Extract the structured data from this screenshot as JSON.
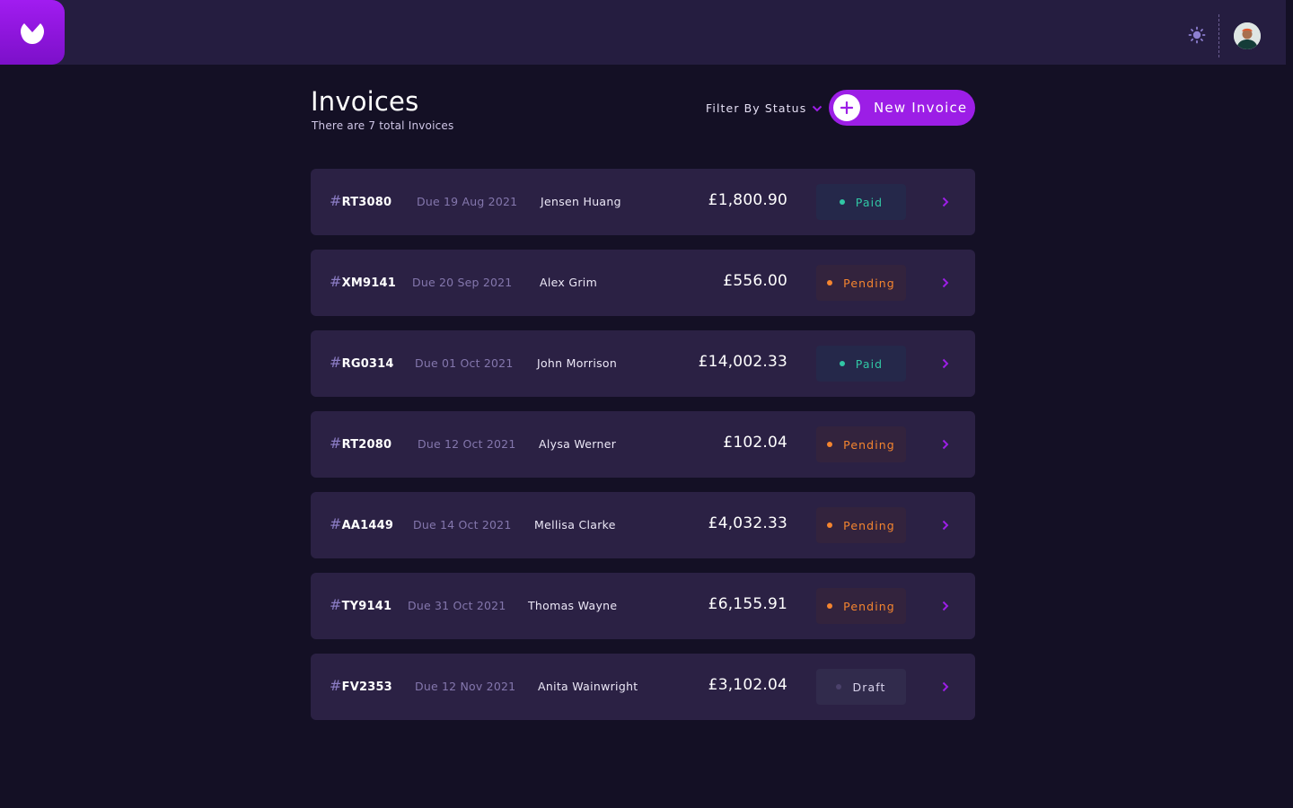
{
  "header": {
    "title": "Invoices",
    "subtitle": "There are 7 total Invoices",
    "filter_label": "Filter By Status",
    "new_invoice_label": "New Invoice"
  },
  "icons": {
    "logo": "logo-icon",
    "theme": "sun-icon",
    "filter": "chevron-down-icon",
    "plus": "plus-icon",
    "row": "chevron-right-icon"
  },
  "colors": {
    "accent": "#9c1ee6",
    "paid": "#31c7a5",
    "pending": "#f5852f",
    "draft": "#d9d3ec"
  },
  "invoices": [
    {
      "hash": "#",
      "id": "RT3080",
      "due": "Due 19 Aug 2021",
      "client": "Jensen Huang",
      "amount": "£1,800.90",
      "status": "Paid"
    },
    {
      "hash": "#",
      "id": "XM9141",
      "due": "Due 20 Sep 2021",
      "client": "Alex Grim",
      "amount": "£556.00",
      "status": "Pending"
    },
    {
      "hash": "#",
      "id": "RG0314",
      "due": "Due 01 Oct 2021",
      "client": "John Morrison",
      "amount": "£14,002.33",
      "status": "Paid"
    },
    {
      "hash": "#",
      "id": "RT2080",
      "due": "Due 12 Oct 2021",
      "client": "Alysa Werner",
      "amount": "£102.04",
      "status": "Pending"
    },
    {
      "hash": "#",
      "id": "AA1449",
      "due": "Due 14 Oct 2021",
      "client": "Mellisa Clarke",
      "amount": "£4,032.33",
      "status": "Pending"
    },
    {
      "hash": "#",
      "id": "TY9141",
      "due": "Due 31 Oct 2021",
      "client": "Thomas Wayne",
      "amount": "£6,155.91",
      "status": "Pending"
    },
    {
      "hash": "#",
      "id": "FV2353",
      "due": "Due 12 Nov 2021",
      "client": "Anita Wainwright",
      "amount": "£3,102.04",
      "status": "Draft"
    }
  ]
}
